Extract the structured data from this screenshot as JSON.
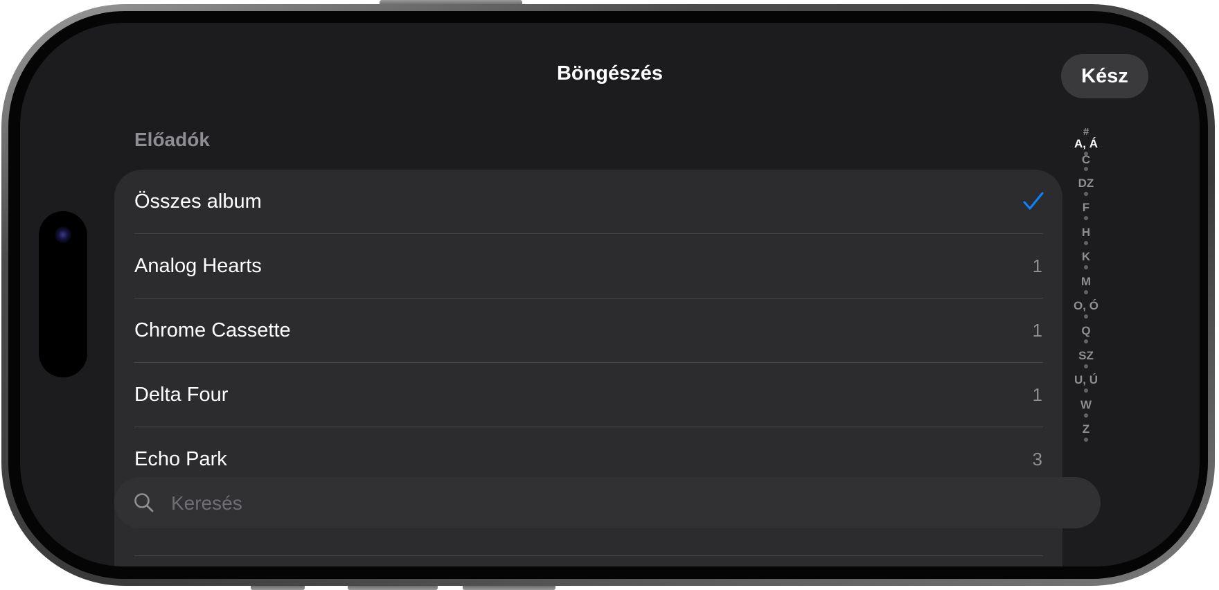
{
  "nav": {
    "title": "Böngészés",
    "done_label": "Kész"
  },
  "section": {
    "header": "Előadók"
  },
  "list": {
    "rows": [
      {
        "label": "Összes album",
        "count": "",
        "selected": true
      },
      {
        "label": "Analog Hearts",
        "count": "1",
        "selected": false
      },
      {
        "label": "Chrome Cassette",
        "count": "1",
        "selected": false
      },
      {
        "label": "Delta Four",
        "count": "1",
        "selected": false
      },
      {
        "label": "Echo Park",
        "count": "3",
        "selected": false
      }
    ]
  },
  "search": {
    "placeholder": "Keresés",
    "value": ""
  },
  "index": {
    "letters": [
      "#",
      "A, Á",
      "C",
      "DZ",
      "F",
      "H",
      "K",
      "M",
      "O, Ó",
      "Q",
      "SZ",
      "U, Ú",
      "W",
      "Z"
    ],
    "active": "A, Á"
  },
  "colors": {
    "background": "#1c1c1e",
    "card": "#2c2c2e",
    "accent": "#0a84ff",
    "secondary_text": "#8e8e93"
  },
  "icons": {
    "checkmark": "checkmark-icon",
    "search": "search-icon"
  }
}
